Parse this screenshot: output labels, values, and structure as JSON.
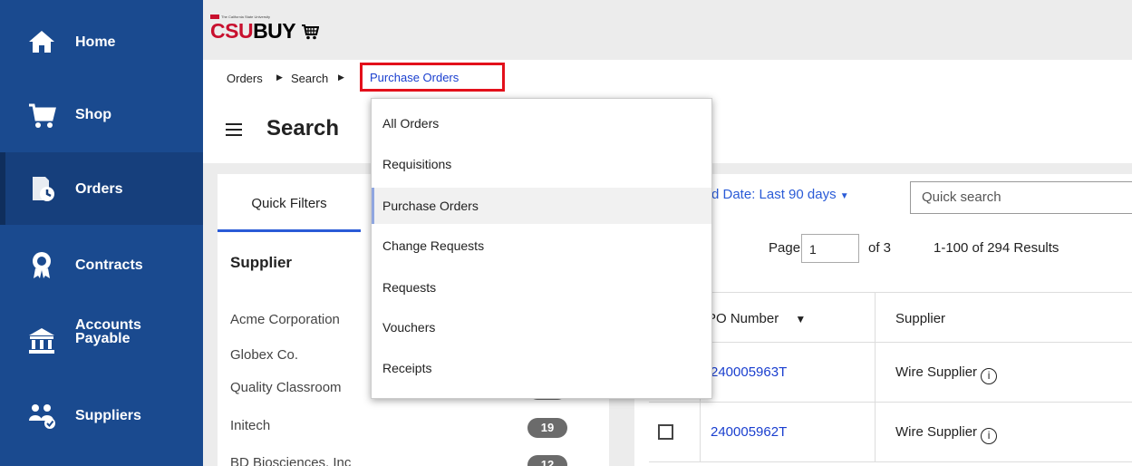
{
  "sidebar": {
    "items": [
      {
        "label": "Home",
        "icon": "home-icon"
      },
      {
        "label": "Shop",
        "icon": "cart-icon"
      },
      {
        "label": "Orders",
        "icon": "orders-icon"
      },
      {
        "label": "Contracts",
        "icon": "contracts-award-icon"
      },
      {
        "label": "Accounts Payable",
        "line1": "Accounts",
        "line2": "Payable",
        "icon": "bank-icon"
      },
      {
        "label": "Suppliers",
        "icon": "suppliers-icon"
      }
    ],
    "active": "Orders"
  },
  "header": {
    "logo_tagline": "The California State University",
    "logo_csu": "CSU",
    "logo_buy": "BUY"
  },
  "breadcrumb": {
    "items": [
      "Orders",
      "Search"
    ],
    "current": "Purchase Orders"
  },
  "page": {
    "title": "Search"
  },
  "dropdown": {
    "items": [
      "All Orders",
      "Requisitions",
      "Purchase Orders",
      "Change Requests",
      "Requests",
      "Vouchers",
      "Receipts"
    ],
    "selected": "Purchase Orders"
  },
  "filters": {
    "tab_label": "Quick Filters",
    "supplier_heading": "Supplier",
    "suppliers": [
      {
        "name": "Acme Corporation",
        "count": ""
      },
      {
        "name": "Globex Co.",
        "count": ""
      },
      {
        "name": "Quality Classroom",
        "count": ""
      },
      {
        "name": "Initech",
        "count": "19"
      },
      {
        "name": "BD Biosciences, Inc",
        "count": "12"
      }
    ]
  },
  "results": {
    "date_filter": "d Date: Last 90 days",
    "search_placeholder": "Quick search",
    "page_label": "Page",
    "page_value": "1",
    "of_label": "of 3",
    "count_label": "1-100 of 294 Results",
    "columns": [
      "PO Number",
      "Supplier"
    ],
    "column_po_visible": "PO Number",
    "rows": [
      {
        "po_number": "240005963T",
        "po_visible": "240005963T",
        "supplier": "Wire Supplier"
      },
      {
        "po_number": "240005962T",
        "po_visible": "240005962T",
        "supplier": "Wire Supplier"
      }
    ]
  },
  "colors": {
    "sidebar": "#1a4a8f",
    "link": "#1a3fcf",
    "highlight_border": "#e3101b",
    "accent": "#2a5bd7"
  }
}
